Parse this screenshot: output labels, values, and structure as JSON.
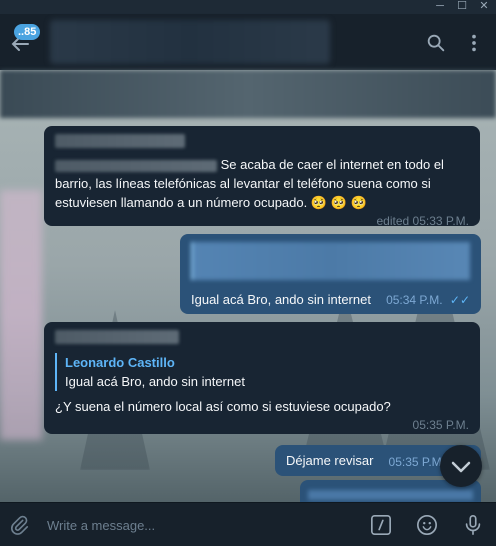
{
  "header": {
    "unread_badge": "..85"
  },
  "messages": [
    {
      "text": "Se acaba de caer el internet en todo el barrio, las líneas telefónicas al levantar el teléfono suena como si estuviesen llamando a un número ocupado.",
      "emojis": "🥺 🥺 🥺",
      "time": "edited 05:33 P.M."
    },
    {
      "text": "Igual acá Bro, ando sin internet",
      "time": "05:34 P.M."
    },
    {
      "reply_name": "Leonardo Castillo",
      "reply_text": "Igual acá Bro, ando sin internet",
      "text": "¿Y suena el número local así como si estuviese ocupado?",
      "time": "05:35 P.M."
    },
    {
      "text": "Déjame revisar",
      "time": "05:35 P.M."
    }
  ],
  "composer": {
    "placeholder": "Write a message..."
  },
  "icons": [
    "back-arrow-icon",
    "search-icon",
    "more-vertical-icon",
    "attach-icon",
    "commands-icon",
    "emoji-icon",
    "microphone-icon",
    "chevron-down-icon"
  ]
}
